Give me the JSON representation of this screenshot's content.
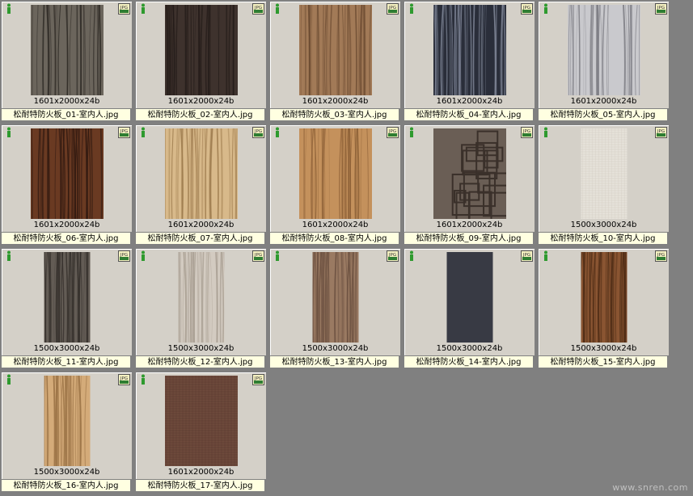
{
  "watermark": "www.snren.com",
  "colors": {
    "background": "#808080",
    "tile": "#d4d0c8",
    "caption_bg": "#ffffe1",
    "info_icon": "#2e9a2e"
  },
  "icons": {
    "info": "info-icon",
    "file_type": "jpg-icon"
  },
  "file_type_label": "JPG",
  "items": [
    {
      "filename": "松耐特防火板_01-室内人.jpg",
      "dims": "1601x2000x24b",
      "tex": {
        "type": "stripes",
        "base": "#6b655c",
        "stroke": "#2f2b26",
        "shape": "tall"
      }
    },
    {
      "filename": "松耐特防火板_02-室内人.jpg",
      "dims": "1601x2000x24b",
      "tex": {
        "type": "stripes",
        "base": "#3e322d",
        "stroke": "#231b18",
        "shape": "tall"
      }
    },
    {
      "filename": "松耐特防火板_03-室内人.jpg",
      "dims": "1601x2000x24b",
      "tex": {
        "type": "stripes",
        "base": "#a27a57",
        "stroke": "#6e4d33",
        "shape": "tall"
      }
    },
    {
      "filename": "松耐特防火板_04-室内人.jpg",
      "dims": "1601x2000x24b",
      "tex": {
        "type": "stripes",
        "base": "#2a2e3a",
        "stroke": "#8c93a5",
        "shape": "tall"
      }
    },
    {
      "filename": "松耐特防火板_05-室内人.jpg",
      "dims": "1601x2000x24b",
      "tex": {
        "type": "stripes",
        "base": "#c9c9cd",
        "stroke": "#77777e",
        "shape": "tall"
      }
    },
    {
      "filename": "松耐特防火板_06-室内人.jpg",
      "dims": "1601x2000x24b",
      "tex": {
        "type": "stripes",
        "base": "#6a3a22",
        "stroke": "#2e1810",
        "shape": "tall"
      }
    },
    {
      "filename": "松耐特防火板_07-室内人.jpg",
      "dims": "1601x2000x24b",
      "tex": {
        "type": "stripes",
        "base": "#d8b98a",
        "stroke": "#9c7a4c",
        "shape": "tall"
      }
    },
    {
      "filename": "松耐特防火板_08-室内人.jpg",
      "dims": "1601x2000x24b",
      "tex": {
        "type": "stripes",
        "base": "#c4915c",
        "stroke": "#8a5e35",
        "shape": "tall"
      }
    },
    {
      "filename": "松耐特防火板_09-室内人.jpg",
      "dims": "1601x2000x24b",
      "tex": {
        "type": "maze",
        "base": "#6a5e55",
        "stroke": "#3a302a",
        "shape": "tall"
      }
    },
    {
      "filename": "松耐特防火板_10-室内人.jpg",
      "dims": "1500x3000x24b",
      "tex": {
        "type": "weave",
        "base": "#e6e2da",
        "stroke": "#c8c2b6",
        "shape": "narrow"
      }
    },
    {
      "filename": "松耐特防火板_11-室内人.jpg",
      "dims": "1500x3000x24b",
      "tex": {
        "type": "stripes",
        "base": "#635c55",
        "stroke": "#2f2a26",
        "shape": "narrow"
      }
    },
    {
      "filename": "松耐特防火板_12-室内人.jpg",
      "dims": "1500x3000x24b",
      "tex": {
        "type": "stripes",
        "base": "#d3cbc1",
        "stroke": "#a69c90",
        "shape": "narrow"
      }
    },
    {
      "filename": "松耐特防火板_13-室内人.jpg",
      "dims": "1500x3000x24b",
      "tex": {
        "type": "stripes",
        "base": "#9a7a62",
        "stroke": "#6b5040",
        "shape": "narrow"
      }
    },
    {
      "filename": "松耐特防火板_14-室内人.jpg",
      "dims": "1500x3000x24b",
      "tex": {
        "type": "plain",
        "base": "#383a44",
        "stroke": "#2a2c34",
        "shape": "narrow"
      }
    },
    {
      "filename": "松耐特防火板_15-室内人.jpg",
      "dims": "1500x3000x24b",
      "tex": {
        "type": "stripes",
        "base": "#8a5532",
        "stroke": "#4a2a14",
        "shape": "narrow"
      }
    },
    {
      "filename": "松耐特防火板_16-室内人.jpg",
      "dims": "1500x3000x24b",
      "tex": {
        "type": "stripes",
        "base": "#d4ab79",
        "stroke": "#9c7447",
        "shape": "narrow"
      }
    },
    {
      "filename": "松耐特防火板_17-室内人.jpg",
      "dims": "1601x2000x24b",
      "tex": {
        "type": "weave",
        "base": "#6e4a3c",
        "stroke": "#4a2e24",
        "shape": "tall"
      }
    }
  ]
}
